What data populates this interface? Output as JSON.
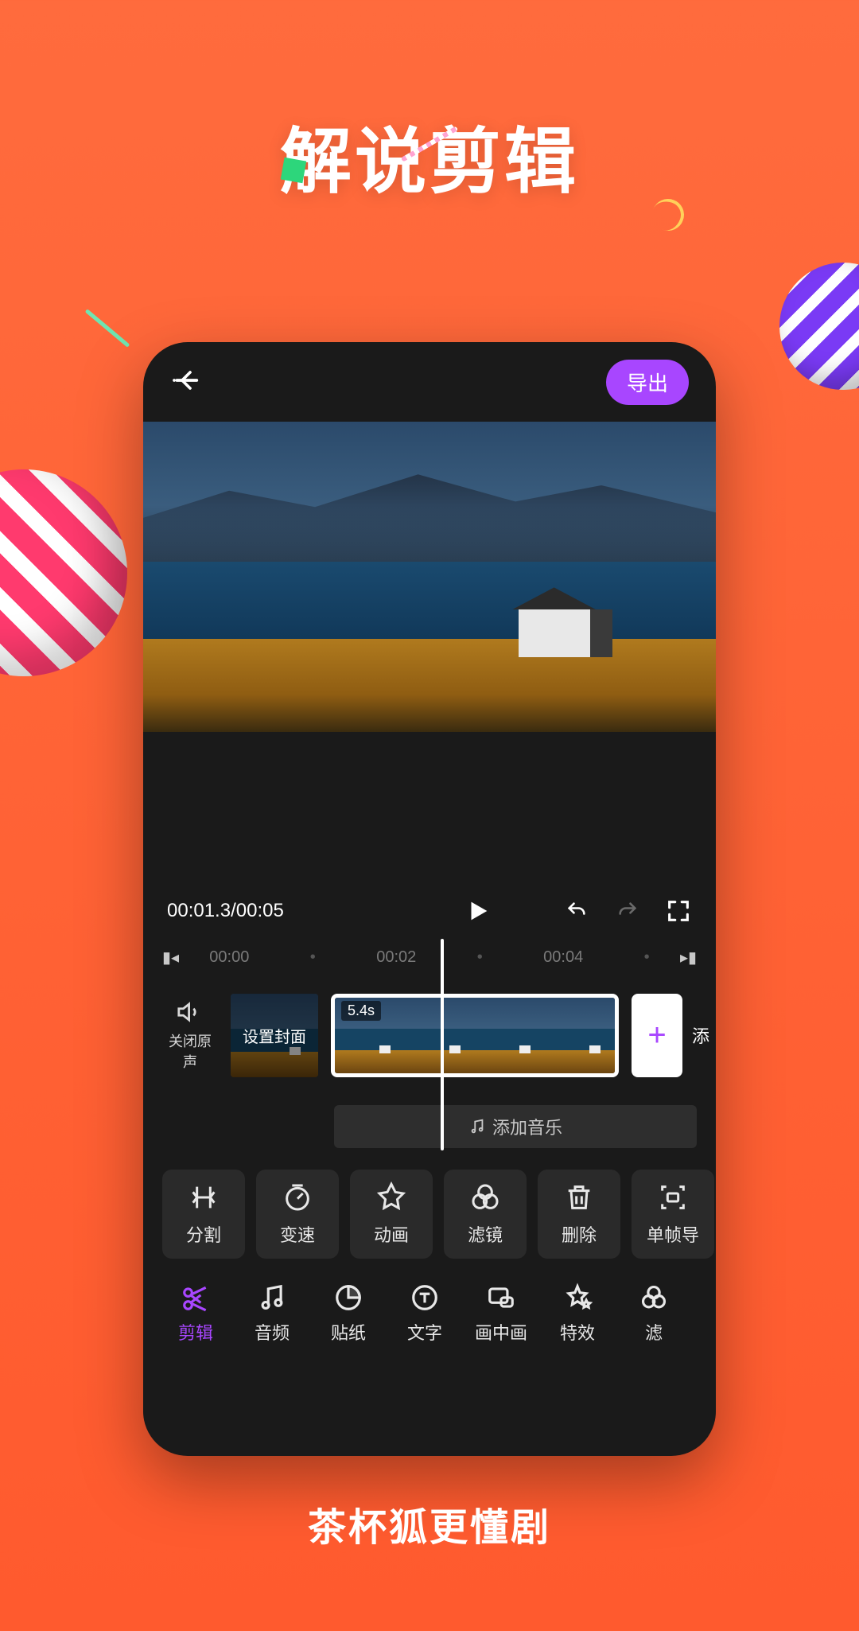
{
  "hero": {
    "title": "解说剪辑"
  },
  "footer": {
    "text": "茶杯狐更懂剧"
  },
  "topbar": {
    "export_label": "导出"
  },
  "playback": {
    "current_time": "00:01.3",
    "total_time": "00:05"
  },
  "ruler": {
    "marks": [
      "00:00",
      "00:02",
      "00:04"
    ]
  },
  "timeline": {
    "mute_label": "关闭原声",
    "cover_label": "设置封面",
    "clip_duration": "5.4s",
    "add_music_label": "添加音乐",
    "add_clip_label": "添"
  },
  "tools": [
    {
      "key": "split",
      "label": "分割"
    },
    {
      "key": "speed",
      "label": "变速"
    },
    {
      "key": "animate",
      "label": "动画"
    },
    {
      "key": "filter",
      "label": "滤镜"
    },
    {
      "key": "delete",
      "label": "删除"
    },
    {
      "key": "export-frame",
      "label": "单帧导"
    }
  ],
  "tabs": [
    {
      "key": "edit",
      "label": "剪辑",
      "active": true
    },
    {
      "key": "audio",
      "label": "音频"
    },
    {
      "key": "sticker",
      "label": "贴纸"
    },
    {
      "key": "text",
      "label": "文字"
    },
    {
      "key": "pip",
      "label": "画中画"
    },
    {
      "key": "fx",
      "label": "特效"
    },
    {
      "key": "filter2",
      "label": "滤"
    }
  ]
}
